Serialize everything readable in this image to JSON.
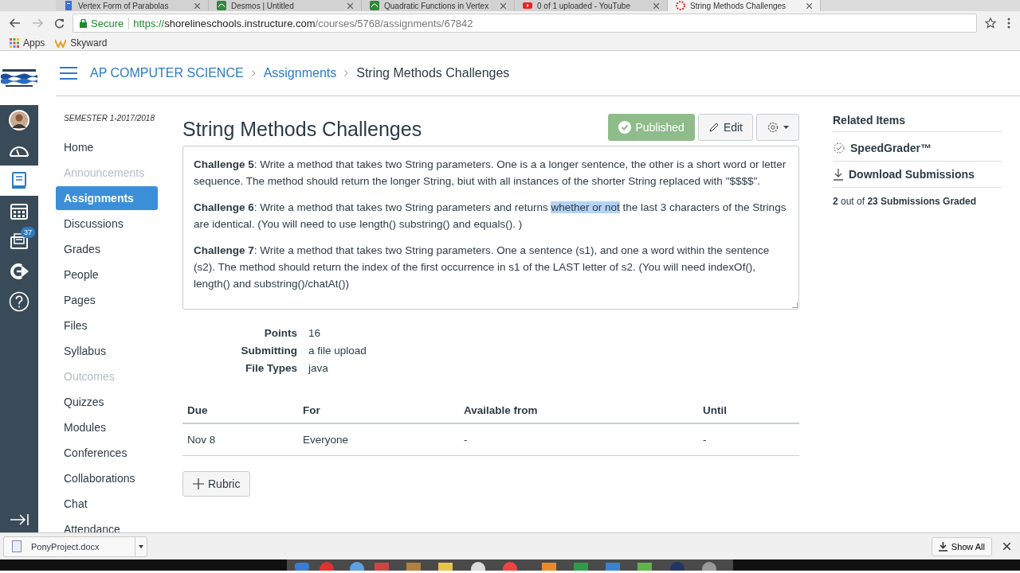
{
  "browser": {
    "tabs": [
      {
        "title": "Vertex Form of Parabolas",
        "kind": "doc",
        "selected": false
      },
      {
        "title": "Desmos | Untitled",
        "kind": "desmos",
        "selected": false
      },
      {
        "title": "Quadratic Functions in Vertex",
        "kind": "desmos",
        "selected": false
      },
      {
        "title": "0 of 1 uploaded - YouTube",
        "kind": "youtube",
        "selected": false
      },
      {
        "title": "String Methods Challenges",
        "kind": "canvas",
        "selected": true
      }
    ],
    "address": {
      "secure_label": "Secure",
      "scheme": "https://",
      "host": "shorelineschools.instructure.com",
      "path": "/courses/5768/assignments/67842"
    },
    "bookmarks": [
      {
        "label": "Apps",
        "kind": "apps"
      },
      {
        "label": "Skyward",
        "kind": "skyward"
      }
    ]
  },
  "global_nav": [
    {
      "kind": "avatar",
      "selected": false
    },
    {
      "kind": "dashboard",
      "selected": false
    },
    {
      "kind": "courses",
      "selected": true
    },
    {
      "kind": "calendar",
      "selected": false
    },
    {
      "kind": "inbox",
      "selected": false,
      "badge": "37"
    },
    {
      "kind": "commons",
      "selected": false
    },
    {
      "kind": "help",
      "selected": false
    }
  ],
  "breadcrumbs": [
    {
      "label": "AP COMPUTER SCIENCE",
      "link": true
    },
    {
      "label": "Assignments",
      "link": true
    },
    {
      "label": "String Methods Challenges",
      "link": false
    }
  ],
  "course_nav": {
    "term": "SEMESTER 1-2017/2018",
    "items": [
      {
        "label": "Home",
        "selected": false,
        "disabled": false
      },
      {
        "label": "Announcements",
        "selected": false,
        "disabled": true
      },
      {
        "label": "Assignments",
        "selected": true,
        "disabled": false
      },
      {
        "label": "Discussions",
        "selected": false,
        "disabled": false
      },
      {
        "label": "Grades",
        "selected": false,
        "disabled": false
      },
      {
        "label": "People",
        "selected": false,
        "disabled": false
      },
      {
        "label": "Pages",
        "selected": false,
        "disabled": false
      },
      {
        "label": "Files",
        "selected": false,
        "disabled": false
      },
      {
        "label": "Syllabus",
        "selected": false,
        "disabled": false
      },
      {
        "label": "Outcomes",
        "selected": false,
        "disabled": true
      },
      {
        "label": "Quizzes",
        "selected": false,
        "disabled": false
      },
      {
        "label": "Modules",
        "selected": false,
        "disabled": false
      },
      {
        "label": "Conferences",
        "selected": false,
        "disabled": false
      },
      {
        "label": "Collaborations",
        "selected": false,
        "disabled": false
      },
      {
        "label": "Chat",
        "selected": false,
        "disabled": false
      },
      {
        "label": "Attendance",
        "selected": false,
        "disabled": false
      }
    ]
  },
  "assignment": {
    "title": "String Methods Challenges",
    "published_label": "Published",
    "published": true,
    "edit_label": "Edit",
    "description": [
      {
        "segments": [
          {
            "text": "**Challenge 5**: Write a method that takes two String parameters. One is a a longer sentence, the other is a short word or letter sequence. The method should return the longer String, biut with all instances of the shorter String replaced with \"$$$$\".",
            "selected": false
          }
        ]
      },
      {
        "segments": [
          {
            "text": "**Challenge 6**: Write a method that takes two String parameters and returns ",
            "selected": false
          },
          {
            "text": "whether or not",
            "selected": true
          },
          {
            "text": " the last 3 characters of the Strings are identical. (You will need to use length() substring() and equals(). )",
            "selected": false
          }
        ]
      },
      {
        "segments": [
          {
            "text": "**Challenge 7**: Write a method that takes two String parameters. One a sentence (s1), and one a word within the sentence (s2). The method should return the index of the first occurrence in s1 of the LAST letter of s2. (You will need indexOf(), length() and substring()/chatAt())",
            "selected": false
          }
        ]
      }
    ],
    "details": [
      {
        "label": "Points",
        "value": "16"
      },
      {
        "label": "Submitting",
        "value": "a file upload"
      },
      {
        "label": "File Types",
        "value": "java"
      }
    ],
    "dates": {
      "columns": [
        "Due",
        "For",
        "Available from",
        "Until"
      ],
      "rows": [
        [
          "Nov 8",
          "Everyone",
          "-",
          "-"
        ]
      ]
    },
    "rubric_label": "Rubric"
  },
  "related": {
    "title": "Related Items",
    "items": [
      {
        "label": "SpeedGrader™",
        "kind": "speedgrader"
      },
      {
        "label": "Download Submissions",
        "kind": "download"
      }
    ],
    "graded": "**2** out of **23 Submissions Graded**"
  },
  "download_bar": {
    "file": "PonyProject.docx",
    "show_all": "Show All"
  }
}
